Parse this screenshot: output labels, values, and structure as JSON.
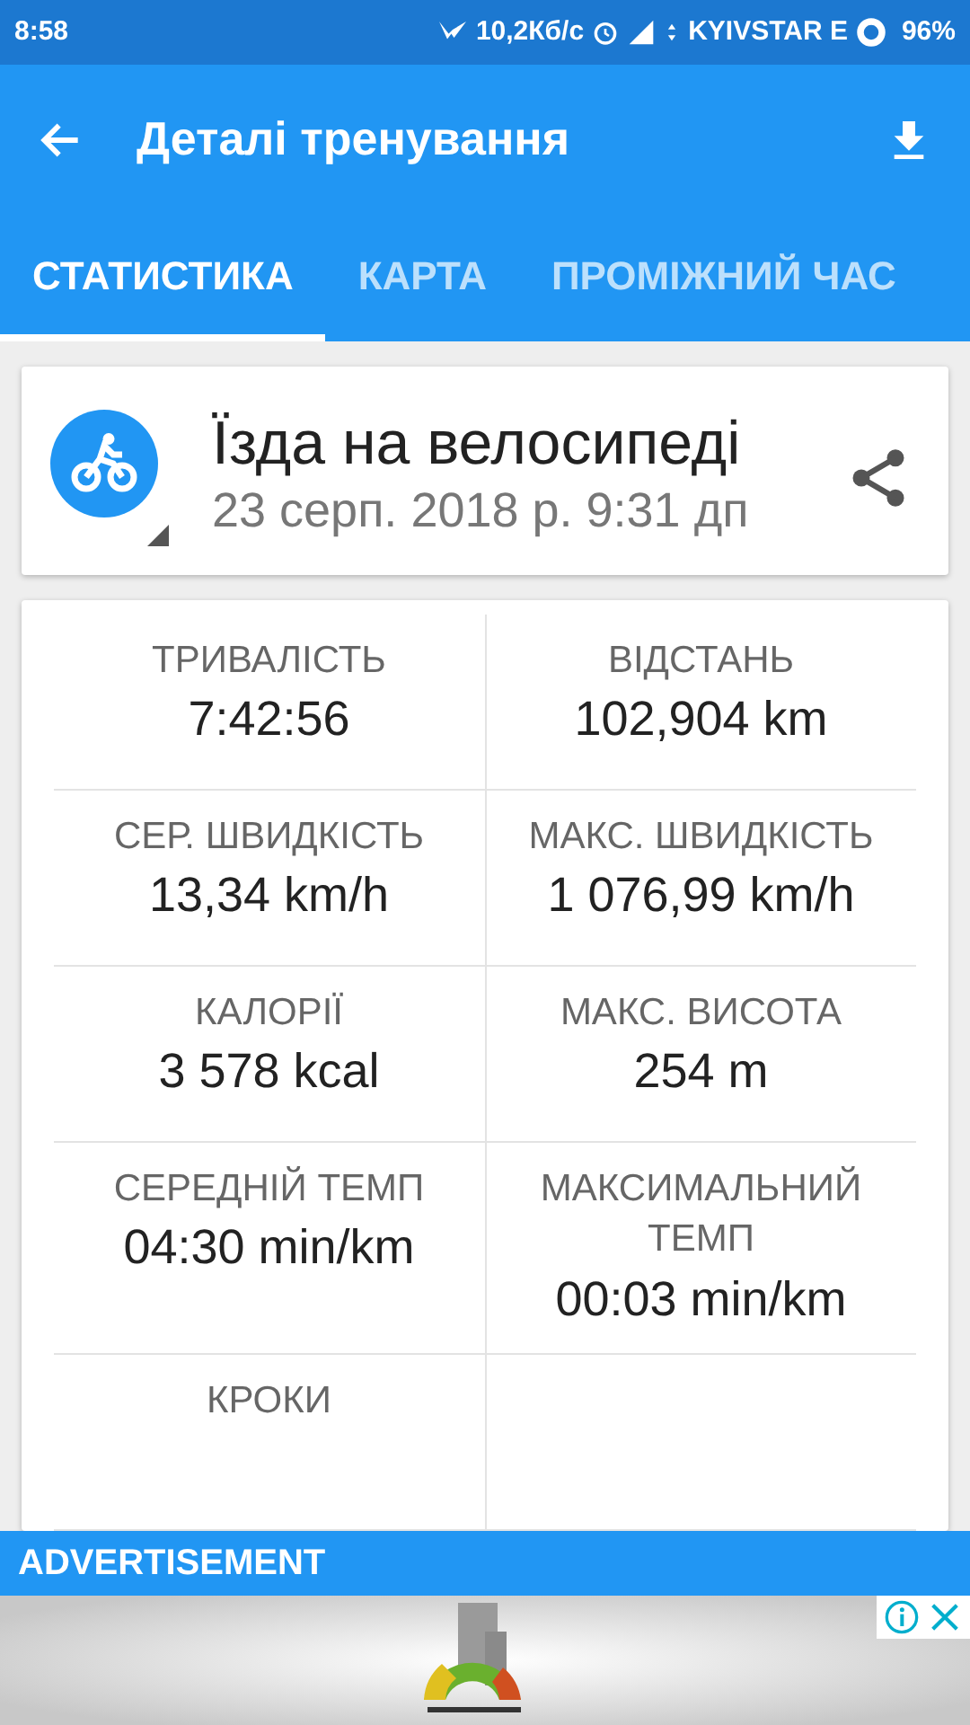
{
  "status_bar": {
    "time": "8:58",
    "net_speed": "10,2Кб/с",
    "carrier": "KYIVSTAR E",
    "battery": "96%"
  },
  "app_bar": {
    "title": "Деталі тренування"
  },
  "tabs": [
    {
      "label": "СТАТИСТИКА",
      "selected": true
    },
    {
      "label": "КАРТА",
      "selected": false
    },
    {
      "label": "ПРОМІЖНИЙ ЧАС",
      "selected": false
    }
  ],
  "workout": {
    "sport": "Їзда на велосипеді",
    "date": "23 серп. 2018 р. 9:31 дп"
  },
  "stats": [
    [
      {
        "label": "ТРИВАЛІСТЬ",
        "value": "7:42:56"
      },
      {
        "label": "ВІДСТАНЬ",
        "value": "102,904 km"
      }
    ],
    [
      {
        "label": "СЕР. ШВИДКІСТЬ",
        "value": "13,34 km/h"
      },
      {
        "label": "МАКС. ШВИДКІСТЬ",
        "value": "1 076,99 km/h"
      }
    ],
    [
      {
        "label": "КАЛОРІЇ",
        "value": "3 578 kcal"
      },
      {
        "label": "МАКС. ВИСОТА",
        "value": "254 m"
      }
    ],
    [
      {
        "label": "СЕРЕДНІЙ ТЕМП",
        "value": "04:30 min/km"
      },
      {
        "label": "МАКСИМАЛЬНИЙ ТЕМП",
        "value": "00:03 min/km"
      }
    ],
    [
      {
        "label": "КРОКИ"
      }
    ]
  ],
  "ad": {
    "label": "ADVERTISEMENT",
    "kind": "picture"
  }
}
